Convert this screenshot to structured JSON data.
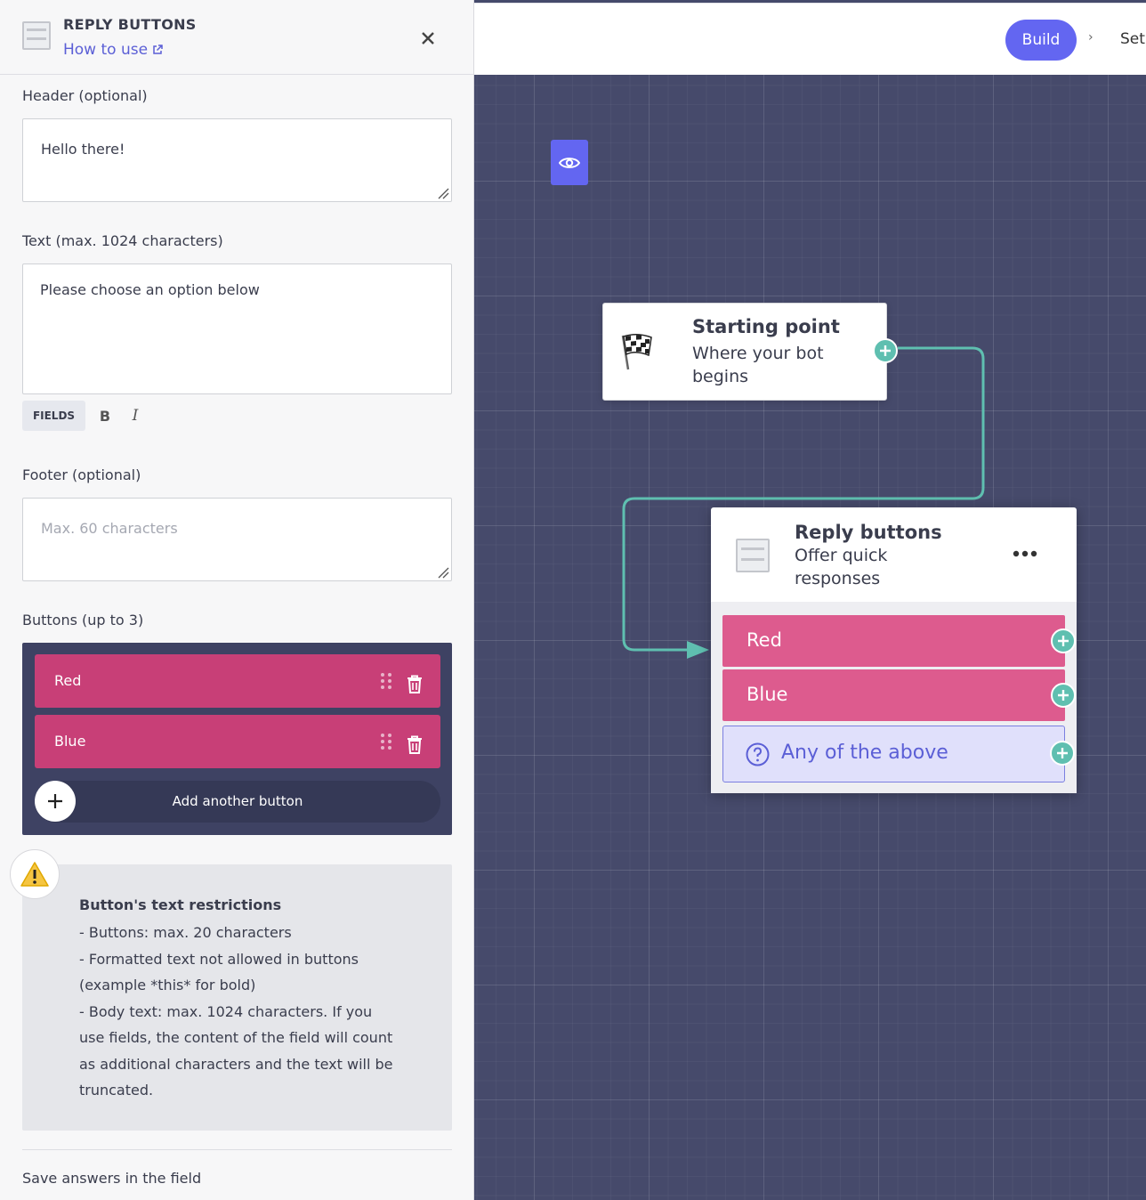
{
  "panel": {
    "title": "REPLY BUTTONS",
    "how_to_use": "How to use",
    "header_label": "Header (optional)",
    "header_value": "Hello there!",
    "text_label": "Text (max. 1024 characters)",
    "text_value": "Please choose an option below",
    "format_bar": {
      "fields": "FIELDS",
      "bold": "B",
      "italic": "I"
    },
    "footer_label": "Footer (optional)",
    "footer_placeholder": "Max. 60 characters",
    "buttons_label": "Buttons (up to 3)",
    "buttons": [
      {
        "label": "Red"
      },
      {
        "label": "Blue"
      }
    ],
    "add_button_label": "Add another button",
    "warning": {
      "title": "Button's text restrictions",
      "lines": [
        "- Buttons: max. 20 characters",
        "- Formatted text not allowed in buttons (example *this* for bold)",
        "- Body text: max. 1024 characters. If you use fields, the content of the field will count as additional characters and the text will be truncated."
      ]
    },
    "save_answers_label": "Save answers in the field"
  },
  "topbar": {
    "build_label": "Build",
    "next_crumb": "Set"
  },
  "canvas": {
    "start_node": {
      "title": "Starting point",
      "subtitle": "Where your bot begins"
    },
    "reply_node": {
      "title": "Reply buttons",
      "subtitle": "Offer quick responses",
      "buttons": [
        "Red",
        "Blue"
      ],
      "fallback": "Any of the above"
    }
  },
  "colors": {
    "accent": "#6366f1",
    "button_pink": "#c83f77",
    "node_button_pink": "#dd5b8e",
    "connector_teal": "#5fbfb0",
    "canvas_bg": "#464a6b"
  }
}
